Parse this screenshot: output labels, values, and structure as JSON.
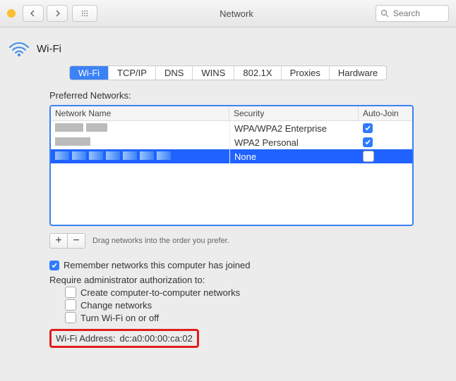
{
  "title": "Network",
  "search": {
    "placeholder": "Search"
  },
  "header": {
    "label": "Wi-Fi"
  },
  "tabs": [
    "Wi-Fi",
    "TCP/IP",
    "DNS",
    "WINS",
    "802.1X",
    "Proxies",
    "Hardware"
  ],
  "section": {
    "preferred_label": "Preferred Networks:"
  },
  "columns": {
    "name": "Network Name",
    "security": "Security",
    "auto": "Auto-Join"
  },
  "networks": [
    {
      "security": "WPA/WPA2 Enterprise",
      "auto": true,
      "selected": false
    },
    {
      "security": "WPA2 Personal",
      "auto": true,
      "selected": false
    },
    {
      "security": "None",
      "auto": false,
      "selected": true
    }
  ],
  "drag_hint": "Drag networks into the order you prefer.",
  "remember": {
    "label": "Remember networks this computer has joined",
    "checked": true
  },
  "require_label": "Require administrator authorization to:",
  "options": [
    {
      "label": "Create computer-to-computer networks",
      "checked": false
    },
    {
      "label": "Change networks",
      "checked": false
    },
    {
      "label": "Turn Wi-Fi on or off",
      "checked": false
    }
  ],
  "wifi_addr": {
    "label": "Wi-Fi Address:",
    "value": "dc:a0:00:00:ca:02"
  }
}
